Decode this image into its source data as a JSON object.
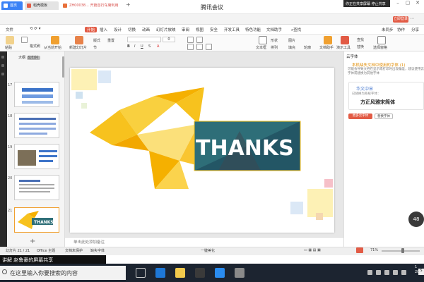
{
  "meeting": {
    "title": "腾讯会议",
    "share_status": "你正在共享屏幕 停止共享"
  },
  "tabs": {
    "home": "首页",
    "wps": "稻壳模板",
    "document": "ZH00038... 开篇自行车席利用",
    "login": "立即登录"
  },
  "menu": {
    "items": [
      "文件",
      "开始",
      "插入",
      "设计",
      "切换",
      "动画",
      "幻灯片放映",
      "审阅",
      "视图",
      "安全",
      "开发工具",
      "特色功能",
      "文档助手"
    ],
    "active_index": 1,
    "search_label": "查找",
    "cloud_label": "未同步",
    "collab_label": "协作",
    "share_label": "分享"
  },
  "ribbon": {
    "paste": "粘贴",
    "format_painter": "格式刷",
    "from_current": "从当前开始",
    "new_slide": "新建幻灯片",
    "layout": "版式",
    "section": "节",
    "reset": "重置",
    "font_size": "0",
    "textbox": "文本框",
    "shapes": "形状",
    "arrange": "排列",
    "doc_helper": "文档助手",
    "speaker_tools": "演示工具",
    "replace": "替换",
    "select_pane": "选择窗格",
    "find": "查找",
    "picture": "图片",
    "fill": "填充",
    "outline": "轮廓"
  },
  "thumbnails": {
    "panel_tabs": [
      "大纲",
      "幻灯片"
    ],
    "numbers": [
      "17",
      "18",
      "19",
      "20",
      "21"
    ],
    "add_label": "+"
  },
  "slide": {
    "headline": "THANKS"
  },
  "notes": {
    "placeholder": "单击此处添加备注"
  },
  "right_panel": {
    "header": "云字体",
    "missing_title": "本机缺失文档中使用的字体 (1)",
    "description": "可能会导致文档在显示或打印时出现偏差，建议使用云字体或替换为其他字体",
    "font_name": "华文中宋",
    "replaced_note": "已替换为系统字体：",
    "replacement_font": "方正风雅宋简体",
    "btn_cloud": "更多云字体",
    "btn_replace": "替换字体"
  },
  "status": {
    "slide_counter": "幻灯片 21 / 21",
    "theme": "Office 主题",
    "protect": "文档未保护",
    "missing_font": "缺失字体",
    "beautify": "一键美化",
    "zoom": "71%",
    "zoom_value": 0.71
  },
  "share_banner": "讲解 赵鲁豪的屏幕共享",
  "zoom_badge": "48",
  "taskbar": {
    "search_placeholder": "在这里输入你要搜索的内容",
    "clock_time": "1",
    "clock_date": "2020",
    "lang": "S"
  },
  "colors": {
    "accent": "#e25b45",
    "slide_yellow": "#f7c21e",
    "slide_teal": "#2e8f8f"
  }
}
